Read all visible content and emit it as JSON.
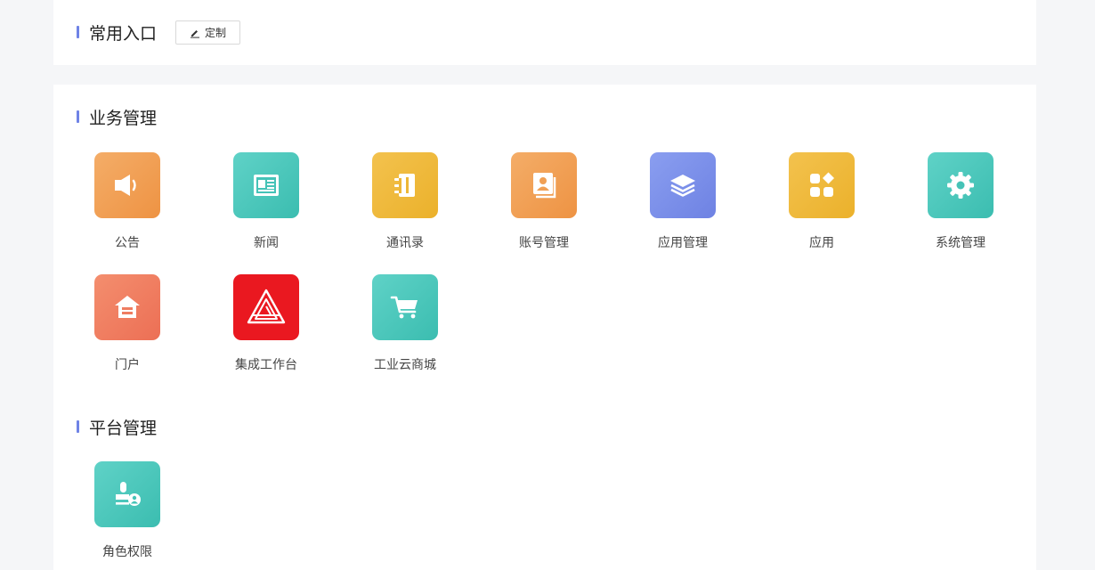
{
  "common": {
    "title": "常用入口",
    "customize_label": "定制"
  },
  "business": {
    "title": "业务管理",
    "items": [
      {
        "label": "公告",
        "icon": "megaphone-icon"
      },
      {
        "label": "新闻",
        "icon": "newspaper-icon"
      },
      {
        "label": "通讯录",
        "icon": "address-book-icon"
      },
      {
        "label": "账号管理",
        "icon": "account-card-icon"
      },
      {
        "label": "应用管理",
        "icon": "layers-icon"
      },
      {
        "label": "应用",
        "icon": "apps-grid-icon"
      },
      {
        "label": "系统管理",
        "icon": "gear-icon"
      },
      {
        "label": "门户",
        "icon": "home-icon"
      },
      {
        "label": "集成工作台",
        "icon": "triangle-logo-icon"
      },
      {
        "label": "工业云商城",
        "icon": "shopping-cart-icon"
      }
    ]
  },
  "platform": {
    "title": "平台管理",
    "items": [
      {
        "label": "角色权限",
        "icon": "role-stamp-icon"
      }
    ]
  },
  "colors": {
    "accent_bar": "#6f83e6",
    "orange": "#ee9343",
    "teal": "#3bbdb0",
    "yellow": "#ebb12b",
    "blue": "#6e82e3",
    "salmon": "#ec6f55",
    "red": "#ea1820"
  }
}
